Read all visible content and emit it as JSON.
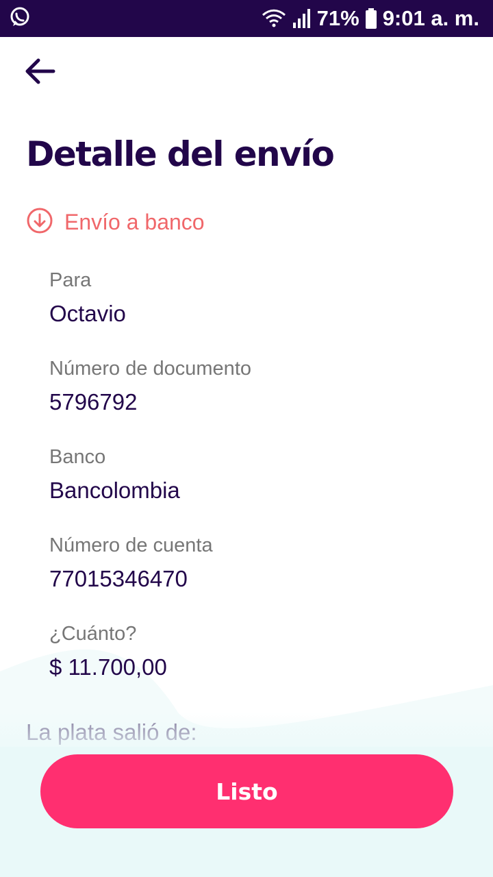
{
  "status_bar": {
    "battery": "71%",
    "time": "9:01 a. m."
  },
  "header": {
    "title": "Detalle del envío"
  },
  "transfer": {
    "type_label": "Envío a banco"
  },
  "fields": [
    {
      "label": "Para",
      "value": "Octavio"
    },
    {
      "label": "Número de documento",
      "value": "5796792"
    },
    {
      "label": "Banco",
      "value": "Bancolombia"
    },
    {
      "label": "Número de cuenta",
      "value": "77015346470"
    },
    {
      "label": "¿Cuánto?",
      "value": "$ 11.700,00"
    }
  ],
  "source": {
    "label": "La plata salió de:"
  },
  "actions": {
    "done_label": "Listo"
  },
  "colors": {
    "primary": "#22064a",
    "accent": "#ff2f70",
    "type_color": "#f0676a"
  },
  "icons": {
    "back": "arrow-left-icon",
    "type": "arrow-down-circle-icon"
  }
}
